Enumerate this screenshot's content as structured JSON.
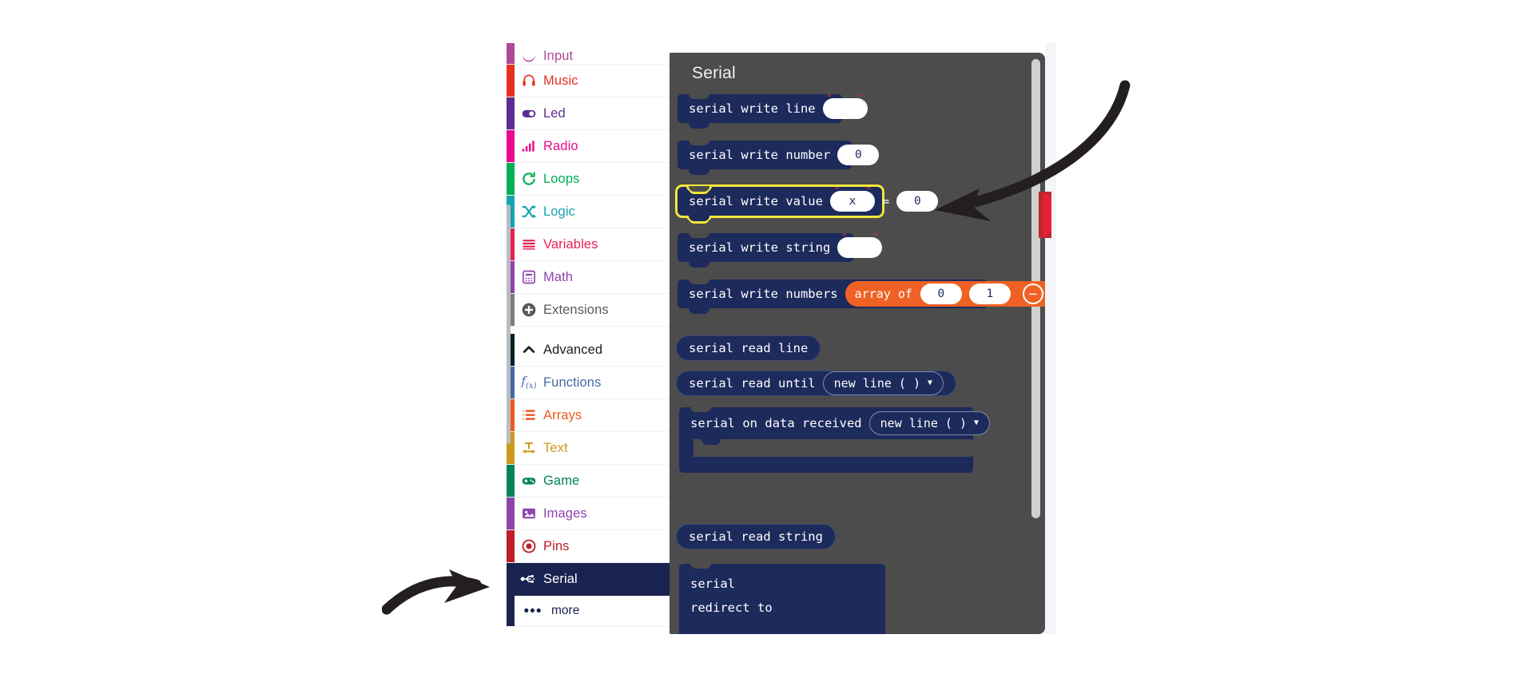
{
  "toolbox": {
    "categories": [
      {
        "label": "Input",
        "icon": "input-icon",
        "color": "#B0479B",
        "text_color": "#B0479B",
        "partial": true
      },
      {
        "label": "Music",
        "icon": "music-icon",
        "color": "#E63022",
        "text_color": "#E63022"
      },
      {
        "label": "Led",
        "icon": "led-icon",
        "color": "#5C2D91",
        "text_color": "#5C2D91"
      },
      {
        "label": "Radio",
        "icon": "radio-icon",
        "color": "#E80C8D",
        "text_color": "#E80C8D"
      },
      {
        "label": "Loops",
        "icon": "loops-icon",
        "color": "#00B053",
        "text_color": "#00B053"
      },
      {
        "label": "Logic",
        "icon": "logic-icon",
        "color": "#12A5B0",
        "text_color": "#12A5B0"
      },
      {
        "label": "Variables",
        "icon": "variables-icon",
        "color": "#E62154",
        "text_color": "#E62154"
      },
      {
        "label": "Math",
        "icon": "math-icon",
        "color": "#8E44AD",
        "text_color": "#8E44AD"
      },
      {
        "label": "Extensions",
        "icon": "extensions-icon",
        "color": "#7D7D7D",
        "text_color": "#5A5A5A"
      }
    ],
    "advanced_section": [
      {
        "label": "Advanced",
        "icon": "chevron-up-icon",
        "color": "#0B2027",
        "text_color": "#1B1D20"
      },
      {
        "label": "Functions",
        "icon": "functions-icon",
        "color": "#4768A5",
        "text_color": "#4768A5"
      },
      {
        "label": "Arrays",
        "icon": "arrays-icon",
        "color": "#EE5A1F",
        "text_color": "#EE5A1F"
      },
      {
        "label": "Text",
        "icon": "text-icon",
        "color": "#CC9A1B",
        "text_color": "#CC9A1B"
      },
      {
        "label": "Game",
        "icon": "game-icon",
        "color": "#008556",
        "text_color": "#008556"
      },
      {
        "label": "Images",
        "icon": "images-icon",
        "color": "#8E44AD",
        "text_color": "#8E44AD"
      },
      {
        "label": "Pins",
        "icon": "pins-icon",
        "color": "#BE1E24",
        "text_color": "#BE1E24"
      },
      {
        "label": "Serial",
        "icon": "serial-usb-icon",
        "color": "#1A2250",
        "text_color": "#FFFFFF",
        "selected": true
      }
    ],
    "more": {
      "label": "more",
      "icon": "ellipsis-icon"
    }
  },
  "flyout": {
    "title": "Serial",
    "background": "#4C4C4C",
    "block_color": "#1D2A5C",
    "highlight_color": "#F2E63B",
    "blocks": [
      {
        "id": "serial-write-line",
        "kind": "statement",
        "label": "serial write line",
        "fields": [
          {
            "type": "string",
            "value": ""
          }
        ]
      },
      {
        "id": "serial-write-number",
        "kind": "statement",
        "label": "serial write number",
        "fields": [
          {
            "type": "number",
            "value": "0"
          }
        ]
      },
      {
        "id": "serial-write-value",
        "kind": "statement",
        "highlighted": true,
        "label": "serial write value",
        "fields": [
          {
            "type": "string",
            "value": "x"
          },
          {
            "type": "operator",
            "value": "="
          },
          {
            "type": "number",
            "value": "0"
          }
        ]
      },
      {
        "id": "serial-write-string",
        "kind": "statement",
        "label": "serial write string",
        "fields": [
          {
            "type": "string",
            "value": ""
          }
        ]
      },
      {
        "id": "serial-write-numbers",
        "kind": "statement",
        "label": "serial write numbers",
        "sub_block": {
          "label": "array of",
          "color": "#EF6124",
          "items": [
            "0",
            "1"
          ],
          "buttons": [
            {
              "name": "remove",
              "glyph": "−"
            },
            {
              "name": "add",
              "glyph": "+"
            }
          ]
        }
      },
      {
        "id": "serial-read-line",
        "kind": "reporter",
        "label": "serial read line"
      },
      {
        "id": "serial-read-until",
        "kind": "reporter",
        "label": "serial read until",
        "dropdown": {
          "value": "new line ( )"
        }
      },
      {
        "id": "serial-on-data-received",
        "kind": "event",
        "label": "serial on data received",
        "dropdown": {
          "value": "new line ( )"
        }
      },
      {
        "id": "serial-read-string",
        "kind": "reporter",
        "label": "serial read string"
      },
      {
        "id": "serial-redirect-to",
        "kind": "statement-two-line",
        "line1": "serial",
        "line2": "redirect to"
      }
    ]
  },
  "annotations": {
    "arrow_top_right": {
      "name": "curved-arrow-pointing-left",
      "color": "#231F20"
    },
    "arrow_bottom_left": {
      "name": "curved-arrow-pointing-right",
      "color": "#231F20"
    }
  }
}
